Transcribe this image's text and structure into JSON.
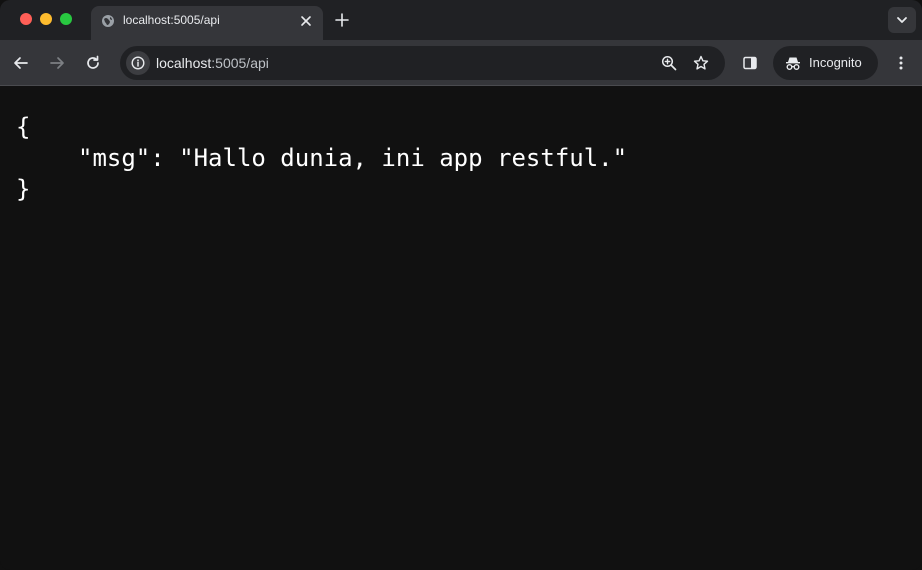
{
  "window": {
    "tab": {
      "title": "localhost:5005/api"
    }
  },
  "toolbar": {
    "url_host": "localhost",
    "url_rest": ":5005/api",
    "incognito_label": "Incognito"
  },
  "json_view": {
    "open_brace": "{",
    "line": "\"msg\": \"Hallo dunia, ini app restful.\"",
    "close_brace": "}"
  },
  "icons": {
    "tab_favicon": "globe-icon",
    "tab_close": "close-icon",
    "new_tab": "plus-icon",
    "tab_search": "chevron-down-icon",
    "back": "arrow-left-icon",
    "forward": "arrow-right-icon",
    "reload": "reload-icon",
    "site_info": "info-icon",
    "zoom": "zoom-in-icon",
    "bookmark": "star-icon",
    "side_panel": "side-panel-icon",
    "incognito": "incognito-icon",
    "menu": "more-vertical-icon"
  },
  "colors": {
    "tabstrip_bg": "#202124",
    "toolbar_bg": "#35363a",
    "content_bg": "#111111",
    "traffic_red": "#ff5f57",
    "traffic_yellow": "#febc2e",
    "traffic_green": "#28c840"
  }
}
